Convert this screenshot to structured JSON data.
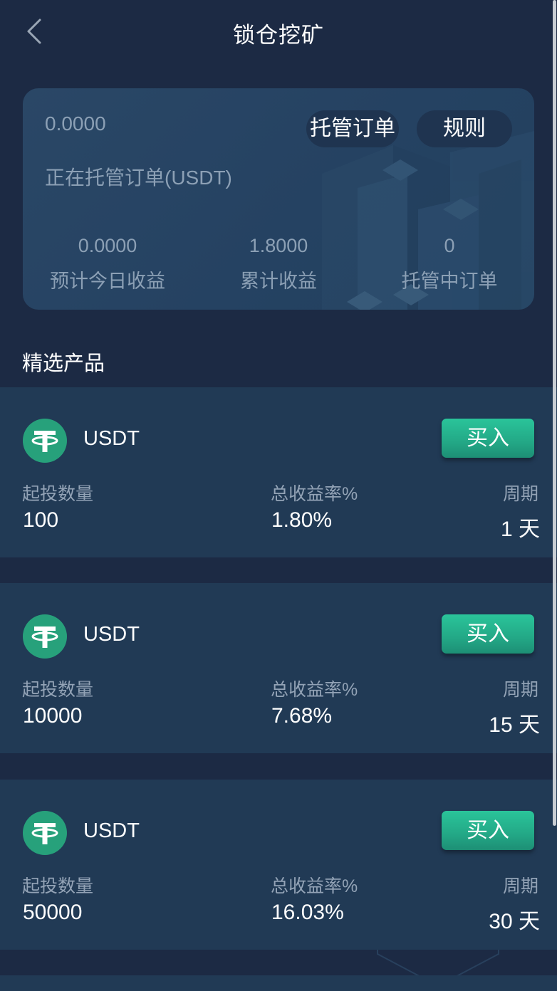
{
  "header": {
    "title": "锁仓挖矿"
  },
  "summary": {
    "balance": "0.0000",
    "balance_label": "正在托管订单(USDT)",
    "orders_button": "托管订单",
    "rules_button": "规则",
    "stats": [
      {
        "value": "0.0000",
        "label": "预计今日收益"
      },
      {
        "value": "1.8000",
        "label": "累计收益"
      },
      {
        "value": "0",
        "label": "托管中订单"
      }
    ]
  },
  "section_title": "精选产品",
  "products": [
    {
      "coin": "USDT",
      "buy_label": "买入",
      "min_label": "起投数量",
      "min": "100",
      "rate_label": "总收益率%",
      "rate": "1.80%",
      "period_label": "周期",
      "period": "1 天"
    },
    {
      "coin": "USDT",
      "buy_label": "买入",
      "min_label": "起投数量",
      "min": "10000",
      "rate_label": "总收益率%",
      "rate": "7.68%",
      "period_label": "周期",
      "period": "15 天"
    },
    {
      "coin": "USDT",
      "buy_label": "买入",
      "min_label": "起投数量",
      "min": "50000",
      "rate_label": "总收益率%",
      "rate": "16.03%",
      "period_label": "周期",
      "period": "30 天"
    }
  ],
  "colors": {
    "background": "#1c2a44",
    "card": "#213a55",
    "accent": "#27a17b",
    "muted": "#8ca0b5"
  },
  "icons": {
    "back": "chevron-left-icon",
    "coin": "tether-icon"
  }
}
